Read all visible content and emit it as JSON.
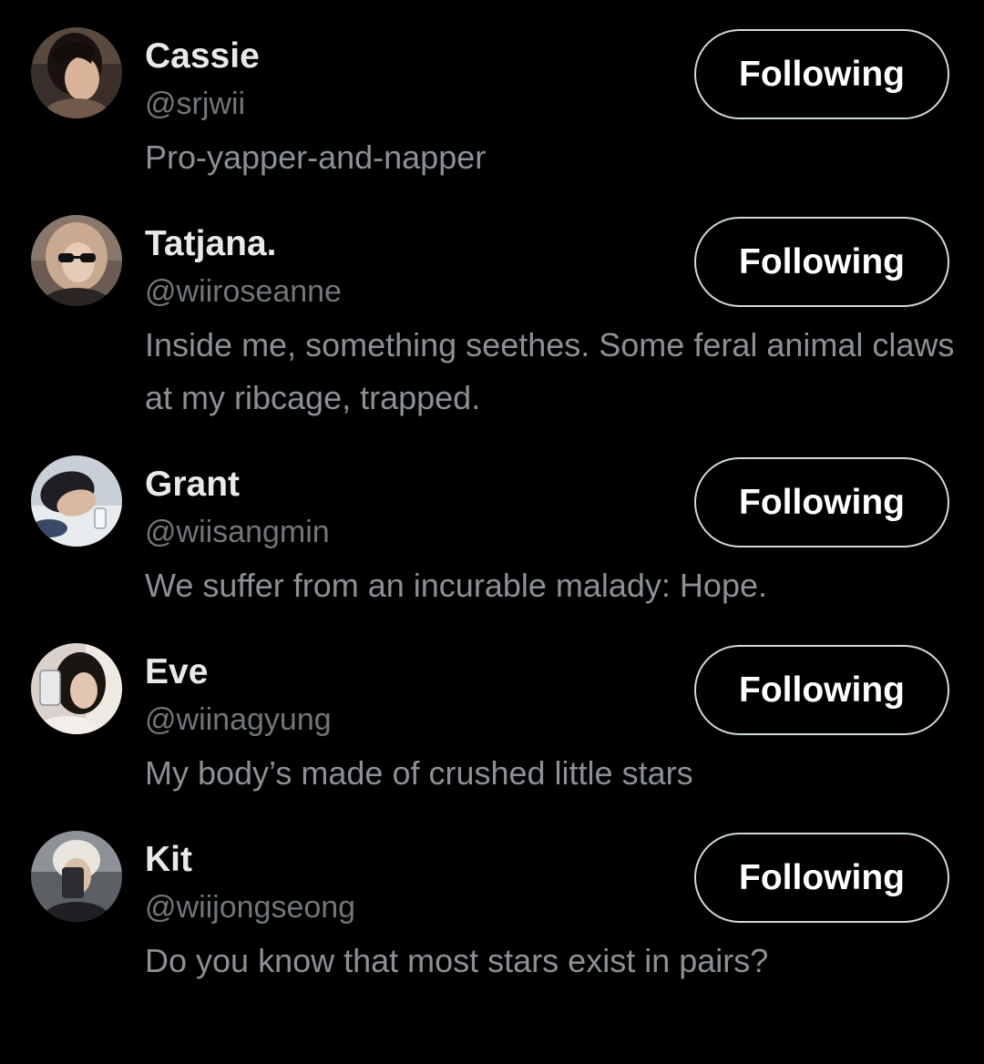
{
  "users": [
    {
      "name": "Cassie",
      "handle": "@srjwii",
      "bio": "Pro-yapper-and-napper",
      "button_label": "Following",
      "avatar_icon": "profile-photo"
    },
    {
      "name": "Tatjana.",
      "handle": "@wiiroseanne",
      "bio": "Inside me, something seethes. Some feral animal claws at my ribcage, trapped.",
      "button_label": "Following",
      "avatar_icon": "profile-photo"
    },
    {
      "name": "Grant",
      "handle": "@wiisangmin",
      "bio": "We suffer from an incurable malady: Hope.",
      "button_label": "Following",
      "avatar_icon": "profile-photo"
    },
    {
      "name": "Eve",
      "handle": "@wiinagyung",
      "bio": "My body’s made of crushed little stars",
      "button_label": "Following",
      "avatar_icon": "profile-photo"
    },
    {
      "name": "Kit",
      "handle": "@wiijongseong",
      "bio": "Do you know that most stars exist in pairs?",
      "button_label": "Following",
      "avatar_icon": "profile-photo"
    }
  ],
  "colors": {
    "background": "#000000",
    "name_text": "#e7e9ea",
    "secondary_text": "#71767b",
    "button_border": "#cfd9de",
    "button_text": "#ffffff"
  }
}
